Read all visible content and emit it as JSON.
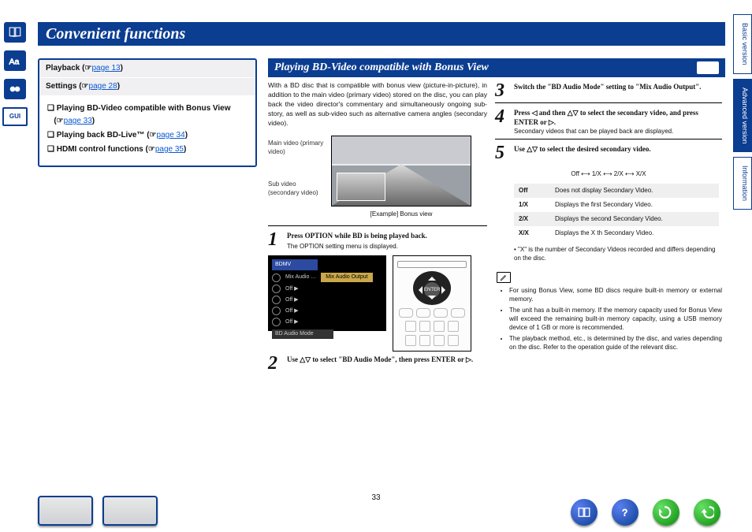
{
  "title": "Convenient functions",
  "page_number": "33",
  "side_tabs": [
    "Basic version",
    "Advanced version",
    "Information"
  ],
  "side_active": 1,
  "nav": {
    "rows": [
      {
        "label": "Playback",
        "ref": "page 13"
      },
      {
        "label": "Settings",
        "ref": "page 28"
      }
    ],
    "items": [
      {
        "label": "Playing BD-Video compatible with Bonus View",
        "ref": "page 33"
      },
      {
        "label": "Playing back BD-Live™",
        "ref": "page 34"
      },
      {
        "label": "HDMI control functions",
        "ref": "page 35"
      }
    ]
  },
  "section_title": "Playing BD-Video compatible with Bonus View",
  "intro": "With a BD disc that is compatible with bonus view (picture-in-picture), in addition to the main video (primary video) stored on the disc, you can play back the video director's commentary and simultaneously ongoing sub-story, as well as sub-video such as alternative camera angles (secondary video).",
  "labels": {
    "main": "Main video (primary video)",
    "sub": "Sub video (secondary video)"
  },
  "pic_caption": "[Example] Bonus view",
  "steps_left": {
    "s1": {
      "text": "Press OPTION while BD is being played back.",
      "note": "The OPTION setting menu is displayed."
    },
    "s2": {
      "text": "Use △▽ to select \"BD Audio Mode\", then press ENTER or ▷."
    }
  },
  "screen": {
    "hdr": "BDMV",
    "row1": "Mix Audio …",
    "row1_hl": "Mix Audio Output",
    "opts": [
      "Off ▶",
      "Off ▶",
      "Off ▶",
      "Off ▶"
    ],
    "bottom": "BD Audio Mode"
  },
  "remote": {
    "enter": "ENTER"
  },
  "steps_right": {
    "s3": "Switch the \"BD Audio Mode\" setting to \"Mix Audio Output\".",
    "s4": "Press ◁ and then △▽ to select the secondary video, and press ENTER or ▷.",
    "s4_note": "Secondary videos that can be played back are displayed.",
    "s5": "Use △▽ to select the desired secondary video."
  },
  "sequence": "Off  ⟷  1/X  ⟷  2/X  ⟷  X/X",
  "table": [
    {
      "k": "Off",
      "v": "Does not display Secondary Video."
    },
    {
      "k": "1/X",
      "v": "Displays the first Secondary Video."
    },
    {
      "k": "2/X",
      "v": "Displays the second Secondary Video."
    },
    {
      "k": "X/X",
      "v": "Displays the X th Secondary Video."
    }
  ],
  "table_foot": "\"X\" is the number of Secondary Videos recorded and differs depending on the disc.",
  "notes": [
    "For using Bonus View, some BD discs require built-in memory or external memory.",
    "The unit has a built-in memory. If the memory capacity used for Bonus View will exceed the remaining built-in memory capacity, using a USB memory device of 1 GB or more is recommended.",
    "The playback method, etc., is determined by the disc, and varies depending on the disc. Refer to the operation guide of the relevant disc."
  ]
}
